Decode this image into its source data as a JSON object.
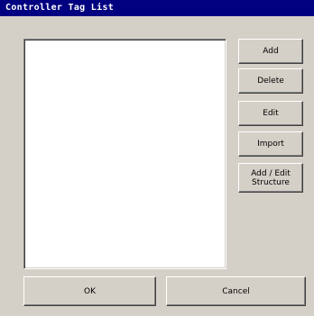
{
  "window": {
    "title": "Controller Tag List"
  },
  "buttons": {
    "add": "Add",
    "delete": "Delete",
    "edit": "Edit",
    "import": "Import",
    "add_edit_structure": "Add / Edit\nStructure",
    "ok": "OK",
    "cancel": "Cancel"
  },
  "tag_list": {
    "items": []
  },
  "colors": {
    "titlebar": "#000080",
    "dialog_background": "#d4d0c8",
    "list_background": "#ffffff"
  }
}
